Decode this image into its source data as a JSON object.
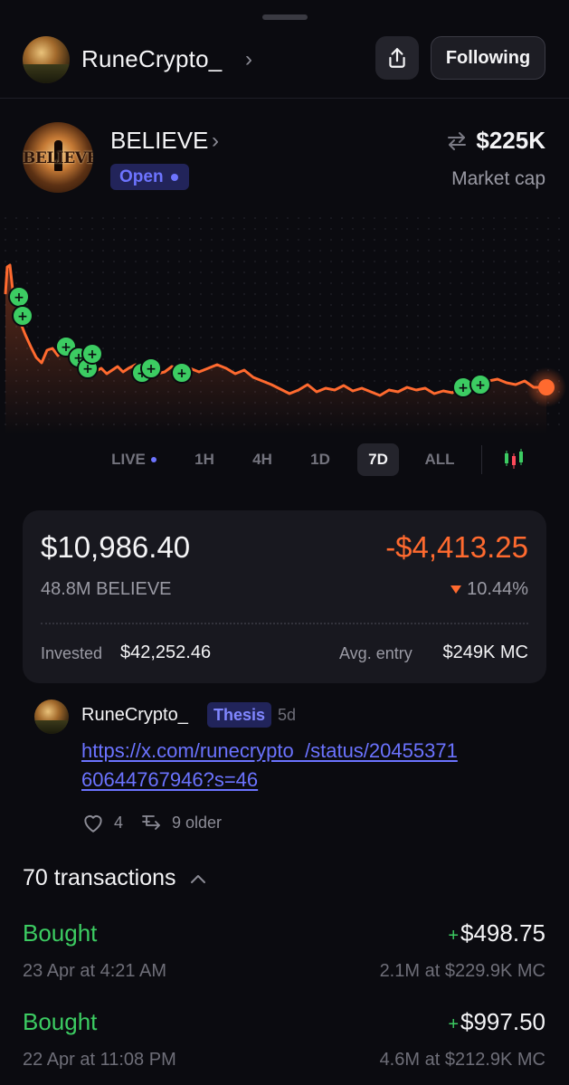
{
  "header": {
    "username": "RuneCrypto_",
    "share_icon": "share-icon",
    "follow_label": "Following"
  },
  "token": {
    "name": "BELIEVE",
    "image_text": "BELIEVE",
    "status": "Open",
    "market_cap": "$225K",
    "market_cap_label": "Market cap",
    "swap_icon": "swap-arrows-icon"
  },
  "chart": {
    "timeframes": [
      "LIVE",
      "1H",
      "4H",
      "1D",
      "7D",
      "ALL"
    ],
    "active_timeframe": "7D",
    "candle_toggle_icon": "candlestick-icon",
    "line_color": "#ff6a2f",
    "buy_marker_color": "#3ccc62"
  },
  "position": {
    "value": "$10,986.40",
    "pnl": "-$4,413.25",
    "holding": "48.8M BELIEVE",
    "pnl_pct": "10.44%",
    "invested_label": "Invested",
    "invested": "$42,252.46",
    "avg_entry_label": "Avg. entry",
    "avg_entry": "$249K MC"
  },
  "thesis": {
    "user": "RuneCrypto_",
    "badge": "Thesis",
    "age": "5d",
    "link": "https://x.com/runecrypto_/status/2045537160644767946?s=46",
    "likes": "4",
    "older": "9 older"
  },
  "transactions": {
    "header": "70 transactions",
    "items": [
      {
        "kind": "Bought",
        "amount": "$498.75",
        "when": "23 Apr at 4:21 AM",
        "detail": "2.1M at $229.9K MC"
      },
      {
        "kind": "Bought",
        "amount": "$997.50",
        "when": "22 Apr at 11:08 PM",
        "detail": "4.6M at $212.9K MC"
      }
    ]
  }
}
